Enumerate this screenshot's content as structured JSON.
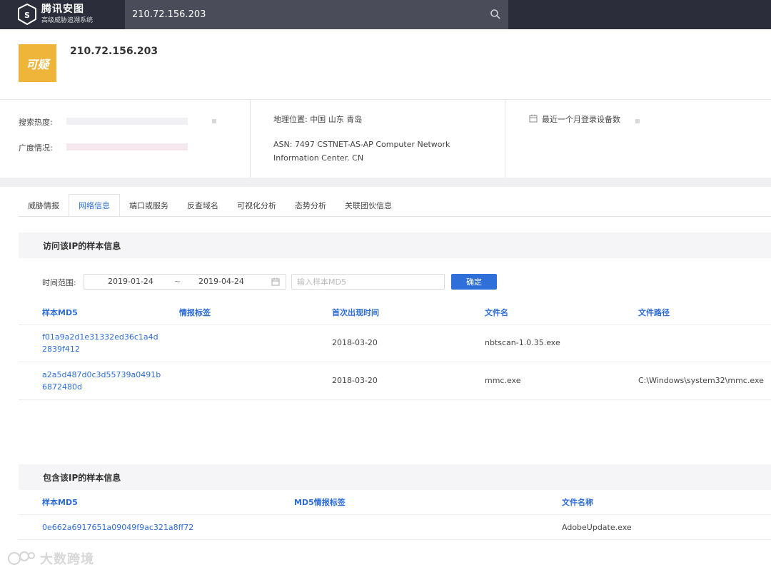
{
  "app": {
    "brand_name": "腾讯安图",
    "brand_sub": "高级威胁追溯系统",
    "search_value": "210.72.156.203"
  },
  "header": {
    "verdict": "可疑",
    "ip": "210.72.156.203",
    "verdict_color": "#efb43a"
  },
  "info": {
    "search_heat_label": "搜索热度:",
    "breadth_label": "广度情况:",
    "geo": "地理位置: 中国 山东 青岛",
    "asn_line1": "ASN: 7497 CSTNET-AS-AP Computer Network",
    "asn_line2": "Information Center. CN",
    "login_devices_label": "最近一个月登录设备数"
  },
  "tabs": [
    {
      "label": "威胁情报"
    },
    {
      "label": "网络信息"
    },
    {
      "label": "端口或服务"
    },
    {
      "label": "反查域名"
    },
    {
      "label": "可视化分析"
    },
    {
      "label": "态势分析"
    },
    {
      "label": "关联团伙信息"
    }
  ],
  "section1": {
    "title": "访问该IP的样本信息",
    "filter_label": "时间范围:",
    "date_start": "2019-01-24",
    "date_sep": "~",
    "date_end": "2019-04-24",
    "md5_placeholder": "输入样本MD5",
    "confirm_label": "确定",
    "columns": [
      "样本MD5",
      "情报标签",
      "首次出现时间",
      "文件名",
      "文件路径"
    ],
    "rows": [
      {
        "md5_1": "f01a9a2d1e31332ed36c1a4d",
        "md5_2": "2839f412",
        "tag": "",
        "first_seen": "2018-03-20",
        "filename": "nbtscan-1.0.35.exe",
        "path": ""
      },
      {
        "md5_1": "a2a5d487d0c3d55739a0491b",
        "md5_2": "6872480d",
        "tag": "",
        "first_seen": "2018-03-20",
        "filename": "mmc.exe",
        "path": "C:\\Windows\\system32\\mmc.exe"
      }
    ]
  },
  "section2": {
    "title": "包含该IP的样本信息",
    "columns": [
      "样本MD5",
      "MD5情报标签",
      "文件名称"
    ],
    "rows": [
      {
        "md5": "0e662a6917651a09049f9ac321a8ff72",
        "tag": "",
        "filename": "AdobeUpdate.exe"
      }
    ]
  },
  "watermark": {
    "text": "大数跨境"
  },
  "colors": {
    "accent": "#2c6cd8",
    "topbar": "#2b2d3a",
    "button": "#2f6fd9"
  }
}
